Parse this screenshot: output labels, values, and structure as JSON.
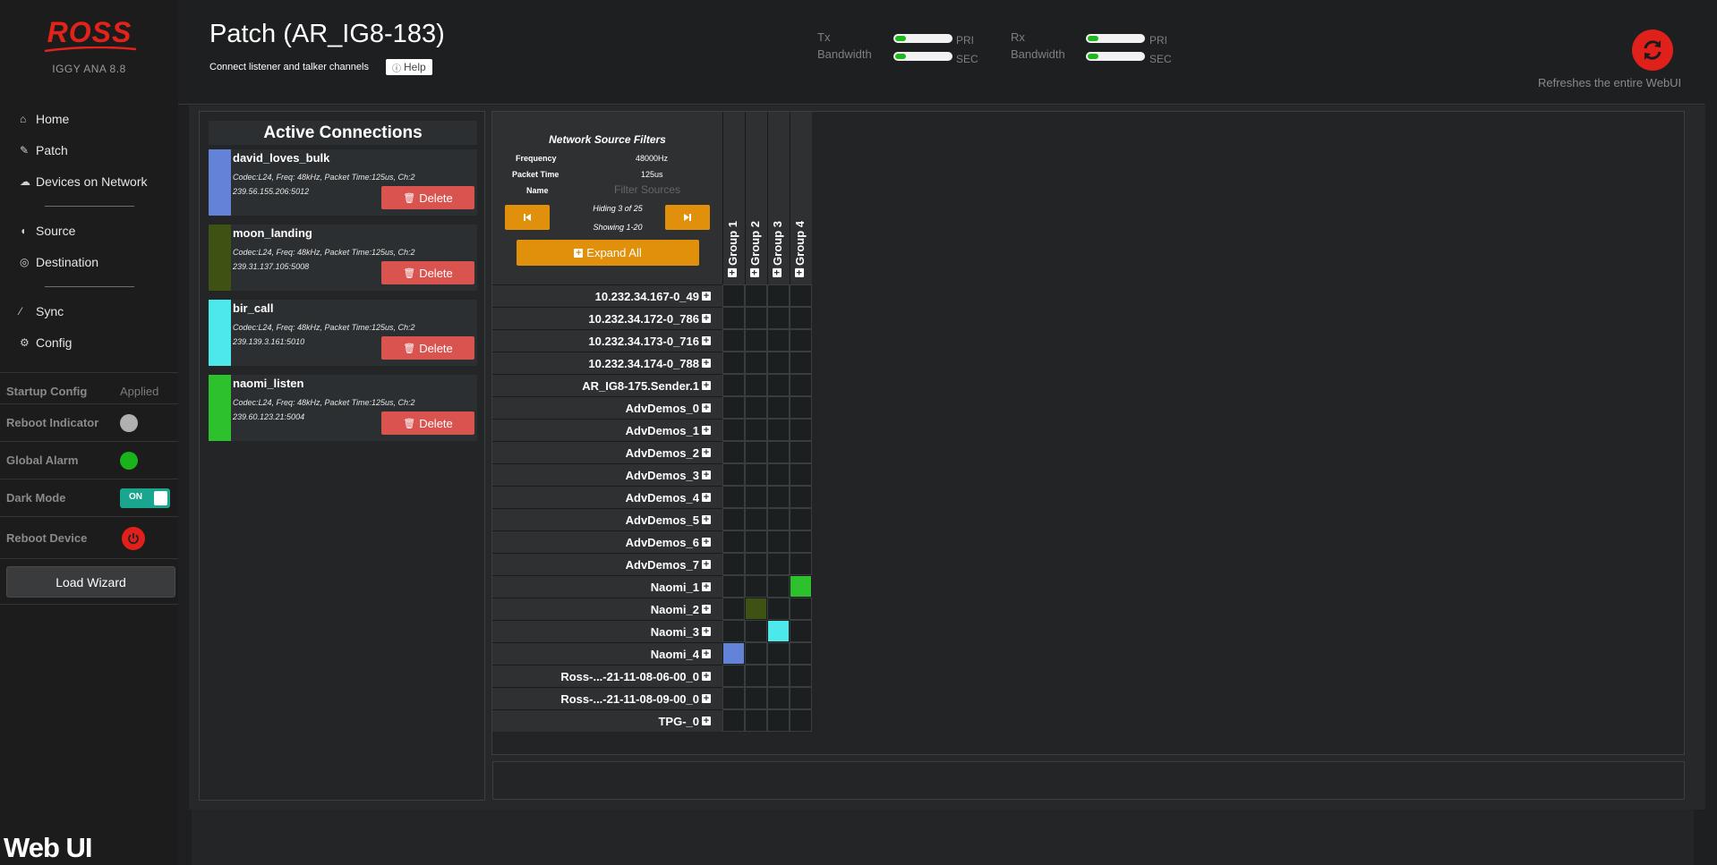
{
  "sidebar": {
    "logo": "ROSS",
    "version": "IGGY ANA 8.8",
    "nav": [
      {
        "label": "Home",
        "icon": "home-icon"
      },
      {
        "label": "Patch",
        "icon": "edit-icon"
      },
      {
        "label": "Devices on Network",
        "icon": "cloud-icon"
      },
      {
        "label": "Source",
        "icon": "broadcast-icon"
      },
      {
        "label": "Destination",
        "icon": "target-icon"
      },
      {
        "label": "Sync",
        "icon": "magic-wand-icon"
      },
      {
        "label": "Config",
        "icon": "gears-icon"
      }
    ],
    "status": {
      "startup_config_label": "Startup Config",
      "startup_config_value": "Applied",
      "reboot_indicator_label": "Reboot Indicator",
      "global_alarm_label": "Global Alarm",
      "dark_mode_label": "Dark Mode",
      "dark_mode_value": "ON",
      "reboot_device_label": "Reboot Device"
    },
    "load_wizard": "Load Wizard",
    "webui_label": "Web UI",
    "colors": {
      "reboot_indicator": "#b0b0b0",
      "global_alarm": "#1bb31b",
      "toggle": "#1aa58f",
      "power": "#e0201a"
    }
  },
  "header": {
    "title": "Patch (AR_IG8-183)",
    "subtitle": "Connect listener and talker channels",
    "help": "Help",
    "tx": {
      "label1": "Tx",
      "label2": "Bandwidth",
      "pri": "PRI",
      "sec": "SEC",
      "pri_level": 0.2,
      "sec_level": 0.2
    },
    "rx": {
      "label1": "Rx",
      "label2": "Bandwidth",
      "pri": "PRI",
      "sec": "SEC",
      "pri_level": 0.2,
      "sec_level": 0.2
    },
    "refresh_text": "Refreshes the entire WebUI"
  },
  "active_connections": {
    "title": "Active Connections",
    "delete_label": "Delete",
    "items": [
      {
        "name": "david_loves_bulk",
        "info": "Codec:L24, Freq: 48kHz, Packet Time:125us, Ch:2",
        "address": "239.56.155.206:5012",
        "color": "#6283d7"
      },
      {
        "name": "moon_landing",
        "info": "Codec:L24, Freq: 48kHz, Packet Time:125us, Ch:2",
        "address": "239.31.137.105:5008",
        "color": "#3d5213"
      },
      {
        "name": "bir_call",
        "info": "Codec:L24, Freq: 48kHz, Packet Time:125us, Ch:2",
        "address": "239.139.3.161:5010",
        "color": "#4de8ec"
      },
      {
        "name": "naomi_listen",
        "info": "Codec:L24, Freq: 48kHz, Packet Time:125us, Ch:2",
        "address": "239.60.123.21:5004",
        "color": "#2ec12e"
      }
    ]
  },
  "filters": {
    "title": "Network Source Filters",
    "frequency_label": "Frequency",
    "frequency_value": "48000Hz",
    "packet_time_label": "Packet Time",
    "packet_time_value": "125us",
    "name_label": "Name",
    "name_placeholder": "Filter Sources",
    "hiding": "Hiding 3 of 25",
    "showing": "Showing 1-20",
    "expand_all": "Expand All",
    "button_color": "#e0900b"
  },
  "groups": [
    "Group 1",
    "Group 2",
    "Group 3",
    "Group 4"
  ],
  "sources": [
    {
      "name": "10.232.34.167-0_49",
      "on": -1
    },
    {
      "name": "10.232.34.172-0_786",
      "on": -1
    },
    {
      "name": "10.232.34.173-0_716",
      "on": -1
    },
    {
      "name": "10.232.34.174-0_788",
      "on": -1
    },
    {
      "name": "AR_IG8-175.Sender.1",
      "on": -1
    },
    {
      "name": "AdvDemos_0",
      "on": -1
    },
    {
      "name": "AdvDemos_1",
      "on": -1
    },
    {
      "name": "AdvDemos_2",
      "on": -1
    },
    {
      "name": "AdvDemos_3",
      "on": -1
    },
    {
      "name": "AdvDemos_4",
      "on": -1
    },
    {
      "name": "AdvDemos_5",
      "on": -1
    },
    {
      "name": "AdvDemos_6",
      "on": -1
    },
    {
      "name": "AdvDemos_7",
      "on": -1
    },
    {
      "name": "Naomi_1",
      "on": 3,
      "color": "#2ec12e"
    },
    {
      "name": "Naomi_2",
      "on": 1,
      "color": "#3d5213"
    },
    {
      "name": "Naomi_3",
      "on": 2,
      "color": "#4de8ec"
    },
    {
      "name": "Naomi_4",
      "on": 0,
      "color": "#6283d7"
    },
    {
      "name": "Ross-...-21-11-08-06-00_0",
      "on": -1
    },
    {
      "name": "Ross-...-21-11-08-09-00_0",
      "on": -1
    },
    {
      "name": "TPG-_0",
      "on": -1
    }
  ]
}
